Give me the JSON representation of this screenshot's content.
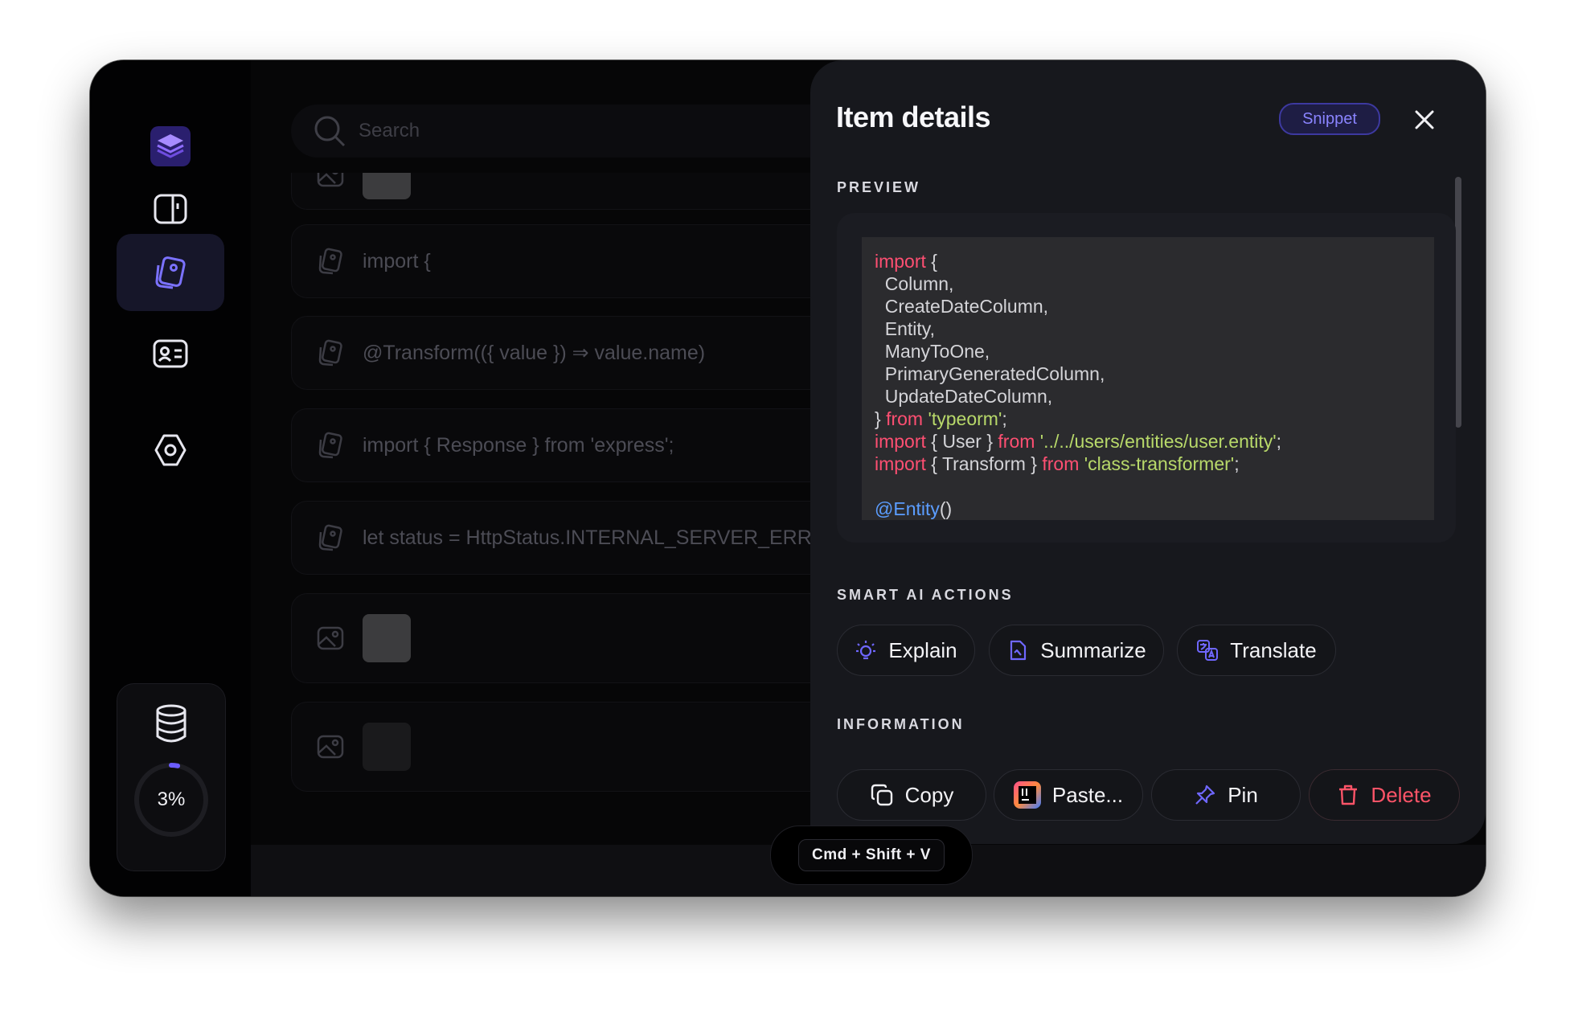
{
  "search": {
    "placeholder": "Search"
  },
  "list": {
    "items": [
      {
        "text": "import {"
      },
      {
        "text": "@Transform(({ value }) ⇒ value.name)"
      },
      {
        "text": "import { Response } from 'express';"
      },
      {
        "text": "let status = HttpStatus.INTERNAL_SERVER_ERRO"
      }
    ]
  },
  "storage": {
    "usage_percent": 3,
    "label": "3%"
  },
  "shortcut": {
    "label": "Cmd + Shift + V"
  },
  "panel": {
    "title": "Item details",
    "badge": "Snippet",
    "preview_heading": "PREVIEW",
    "ai_heading": "SMART AI ACTIONS",
    "info_heading": "INFORMATION",
    "ai_actions": {
      "explain": "Explain",
      "summarize": "Summarize",
      "translate": "Translate"
    },
    "info_actions": {
      "copy": "Copy",
      "paste": "Paste...",
      "pin": "Pin",
      "delete": "Delete"
    }
  },
  "code": {
    "lines": [
      [
        {
          "t": "import",
          "c": "k"
        },
        {
          "t": " {"
        }
      ],
      [
        {
          "t": "  Column,"
        }
      ],
      [
        {
          "t": "  CreateDateColumn,"
        }
      ],
      [
        {
          "t": "  Entity,"
        }
      ],
      [
        {
          "t": "  ManyToOne,"
        }
      ],
      [
        {
          "t": "  PrimaryGeneratedColumn,"
        }
      ],
      [
        {
          "t": "  UpdateDateColumn,"
        }
      ],
      [
        {
          "t": "} "
        },
        {
          "t": "from",
          "c": "k"
        },
        {
          "t": " "
        },
        {
          "t": "'typeorm'",
          "c": "s"
        },
        {
          "t": ";"
        }
      ],
      [
        {
          "t": "import",
          "c": "k"
        },
        {
          "t": " { User } "
        },
        {
          "t": "from",
          "c": "k"
        },
        {
          "t": " "
        },
        {
          "t": "'../../users/entities/user.entity'",
          "c": "s"
        },
        {
          "t": ";"
        }
      ],
      [
        {
          "t": "import",
          "c": "k"
        },
        {
          "t": " { Transform } "
        },
        {
          "t": "from",
          "c": "k"
        },
        {
          "t": " "
        },
        {
          "t": "'class-transformer'",
          "c": "s"
        },
        {
          "t": ";"
        }
      ],
      [
        {
          "t": ""
        }
      ],
      [
        {
          "t": "@Entity",
          "c": "d"
        },
        {
          "t": "()"
        }
      ]
    ]
  },
  "colors": {
    "accent": "#7b72ff",
    "keyword": "#ff4f72",
    "string": "#b8d96a",
    "decorator": "#5b9dff",
    "danger": "#ff5468"
  }
}
